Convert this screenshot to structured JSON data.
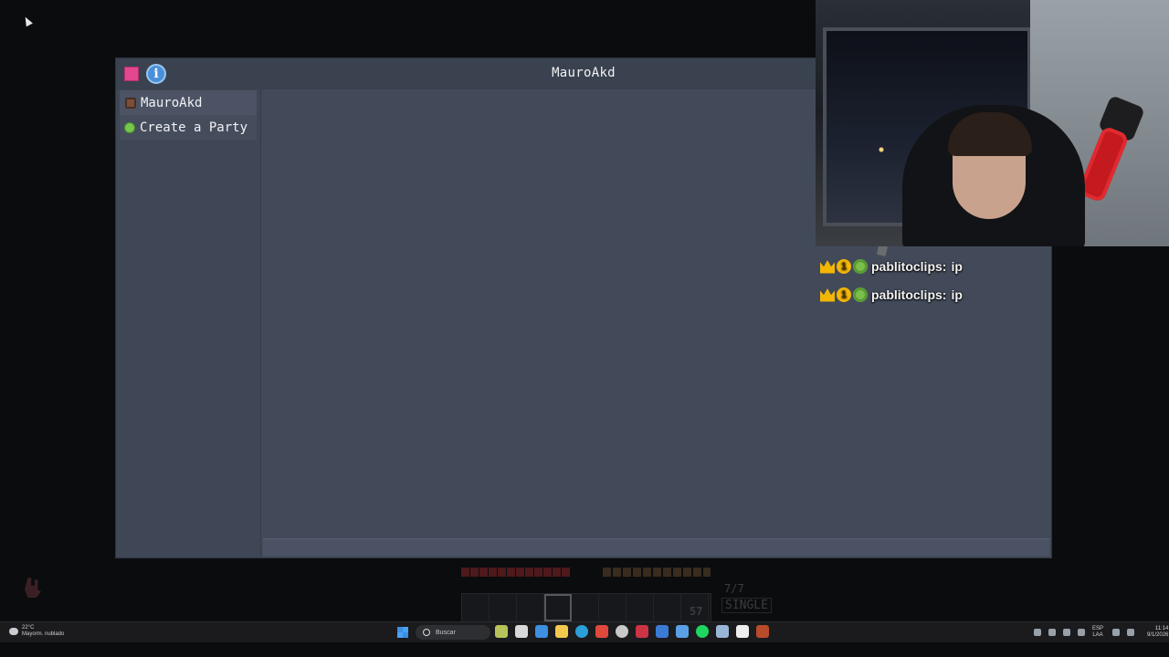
{
  "panel": {
    "title": "MauroAkd",
    "info_glyph": "i",
    "sidebar": [
      {
        "label": "MauroAkd",
        "icon": "player-head-icon"
      },
      {
        "label": "Create a Party",
        "icon": "green-dot-icon"
      }
    ]
  },
  "chat": {
    "messages": [
      {
        "user": "pablitoclips:",
        "text": "ip",
        "badge_number": "1"
      },
      {
        "user": "pablitoclips:",
        "text": "ip",
        "badge_number": "1"
      }
    ]
  },
  "hud": {
    "level": "7/7",
    "item_count": "57",
    "mode": "SINGLE"
  },
  "taskbar": {
    "weather_temp": "22°C",
    "weather_desc": "Mayorm. nublado",
    "search_placeholder": "Buscar",
    "lang_top": "ESP",
    "lang_bottom": "LAA",
    "time": "11:14",
    "date": "9/1/2026"
  },
  "colors": {
    "accent_close": "#e2478f",
    "info_blue": "#4a8fd8",
    "online_green": "#74c94c",
    "panel_bg": "#424a5a"
  }
}
